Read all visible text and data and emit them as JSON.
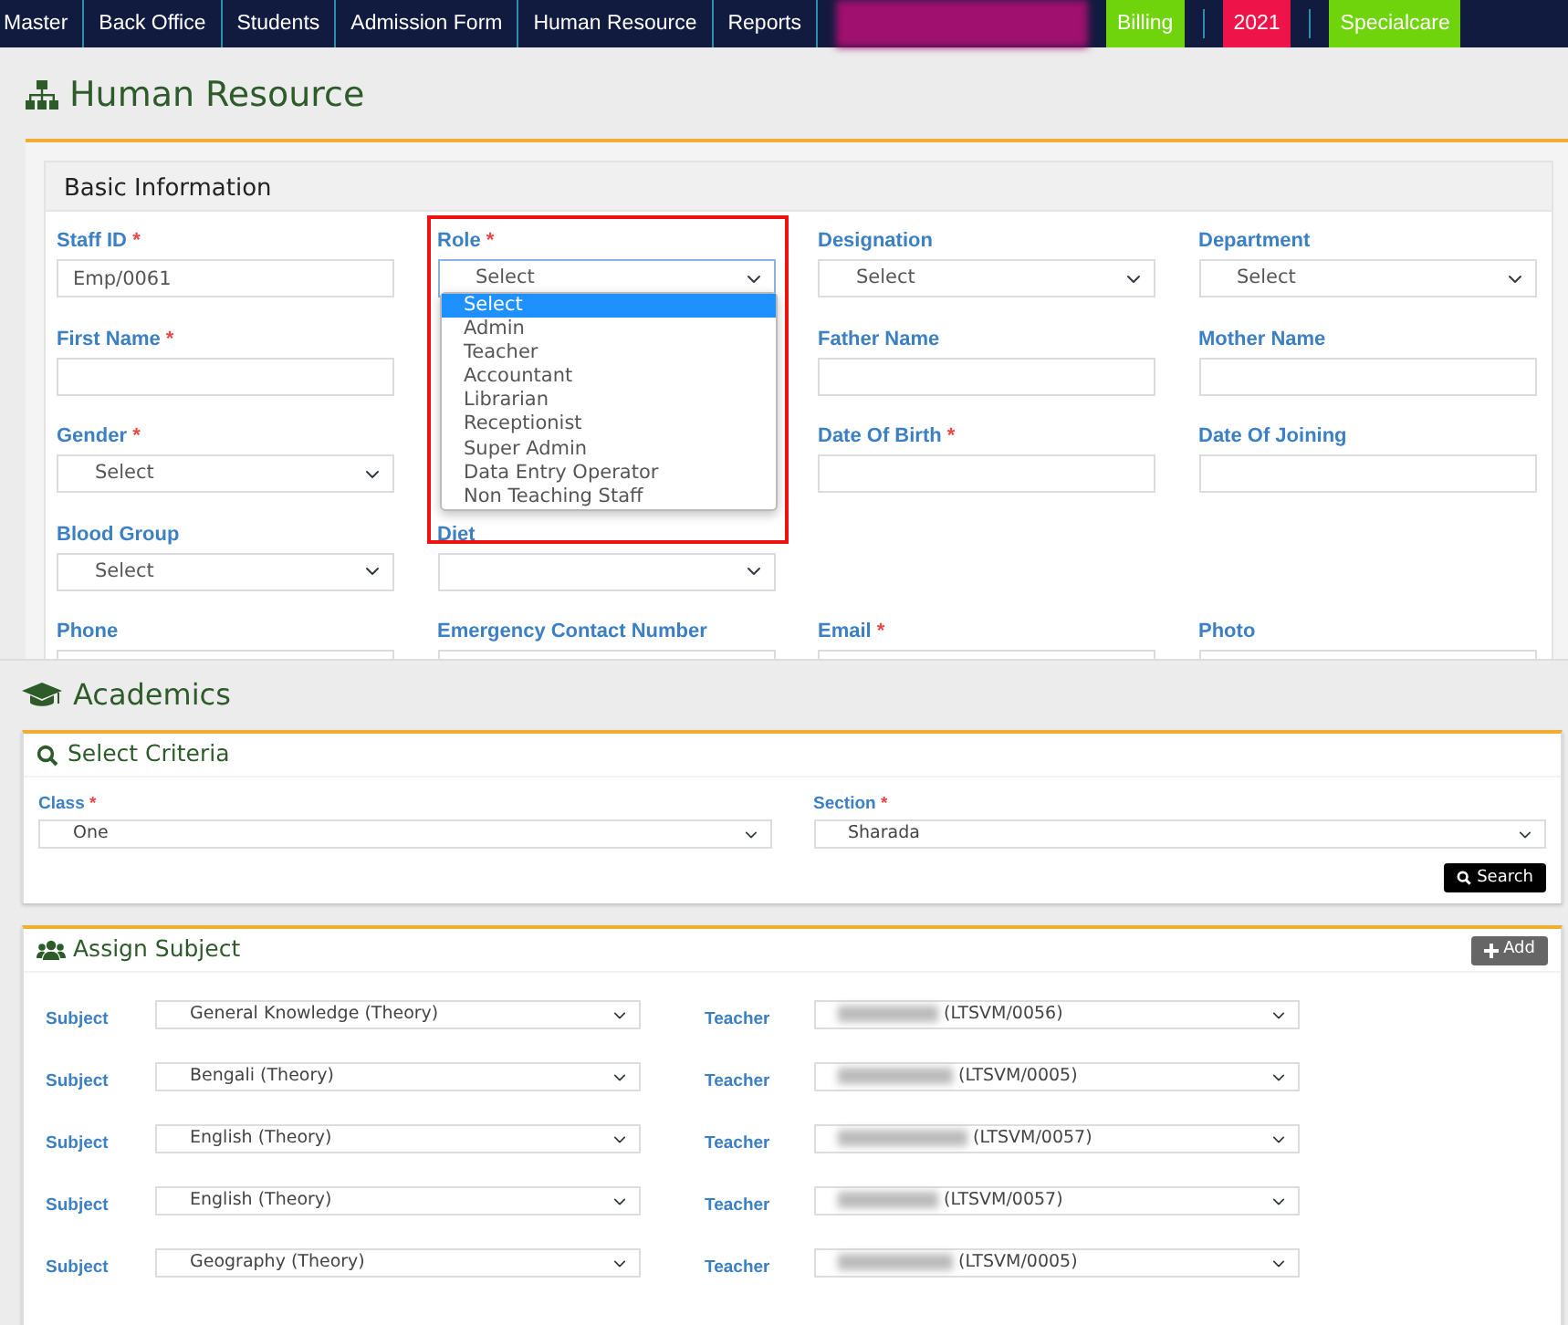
{
  "navbar": {
    "items": [
      {
        "kind": "link",
        "label": "Master"
      },
      {
        "kind": "link",
        "label": "Back Office"
      },
      {
        "kind": "link",
        "label": "Students"
      },
      {
        "kind": "link",
        "label": "Admission Form"
      },
      {
        "kind": "link",
        "label": "Human Resource"
      },
      {
        "kind": "link",
        "label": "Reports"
      },
      {
        "kind": "redacted",
        "color": "#a0106e"
      },
      {
        "kind": "badge",
        "label": "Billing",
        "color": "#6fd40c"
      },
      {
        "kind": "badge",
        "label": "2021",
        "color": "#ee1348"
      },
      {
        "kind": "badge",
        "label": "Specialcare",
        "color": "#6fd40c"
      }
    ]
  },
  "human_resource": {
    "title": "Human Resource",
    "card_title": "Basic Information",
    "rows": [
      [
        {
          "kind": "text",
          "label": "Staff ID",
          "required_mark": "*",
          "value": "Emp/0061"
        },
        {
          "kind": "select",
          "label": "Role",
          "required_mark": "*",
          "value": "Select",
          "expanded": true
        },
        {
          "kind": "select",
          "label": "Designation",
          "value": "Select"
        },
        {
          "kind": "select",
          "label": "Department",
          "value": "Select"
        }
      ],
      [
        {
          "kind": "text",
          "label": "First Name",
          "required_mark": "*"
        },
        null,
        {
          "kind": "text",
          "label": "Father Name"
        },
        {
          "kind": "text",
          "label": "Mother Name"
        }
      ],
      [
        {
          "kind": "select",
          "label": "Gender",
          "required_mark": "*",
          "value": "Select"
        },
        null,
        {
          "kind": "text",
          "label": "Date Of Birth",
          "required_mark": "*"
        },
        {
          "kind": "text",
          "label": "Date Of Joining"
        }
      ],
      [
        {
          "kind": "select",
          "label": "Blood Group",
          "value": "Select"
        },
        {
          "kind": "select",
          "label": "Diet"
        },
        null,
        null
      ],
      [
        {
          "kind": "text",
          "label": "Phone"
        },
        {
          "kind": "text",
          "label": "Emergency Contact Number"
        },
        {
          "kind": "text",
          "label": "Email",
          "required_mark": "*"
        },
        {
          "kind": "text",
          "label": "Photo"
        }
      ]
    ],
    "role_options": [
      {
        "label": "Select",
        "selected": true
      },
      {
        "label": "Admin",
        "selected": false
      },
      {
        "label": "Teacher",
        "selected": false
      },
      {
        "label": "Accountant",
        "selected": false
      },
      {
        "label": "Librarian",
        "selected": false
      },
      {
        "label": "Receptionist",
        "selected": false
      },
      {
        "label": "Super Admin",
        "selected": false
      },
      {
        "label": "Data Entry Operator",
        "selected": false
      },
      {
        "label": "Non Teaching Staff",
        "selected": false
      }
    ]
  },
  "academics": {
    "title": "Academics",
    "criteria": {
      "title": "Select Criteria",
      "fields": [
        {
          "label": "Class",
          "required_mark": "*",
          "value": "One"
        },
        {
          "label": "Section",
          "required_mark": "*",
          "value": "Sharada"
        }
      ],
      "button": "Search"
    },
    "assign": {
      "title": "Assign Subject",
      "button": "Add",
      "rows": [
        {
          "subject_label": "Subject",
          "subject": "General Knowledge (Theory)",
          "teacher_label": "Teacher",
          "teacher": "(LTSVM/0056)"
        },
        {
          "subject_label": "Subject",
          "subject": "Bengali (Theory)",
          "teacher_label": "Teacher",
          "teacher": "(LTSVM/0005)"
        },
        {
          "subject_label": "Subject",
          "subject": "English (Theory)",
          "teacher_label": "Teacher",
          "teacher": "(LTSVM/0057)"
        },
        {
          "subject_label": "Subject",
          "subject": "English (Theory)",
          "teacher_label": "Teacher",
          "teacher": "(LTSVM/0057)"
        },
        {
          "subject_label": "Subject",
          "subject": "Geography (Theory)",
          "teacher_label": "Teacher",
          "teacher": "(LTSVM/0005)"
        }
      ]
    }
  }
}
